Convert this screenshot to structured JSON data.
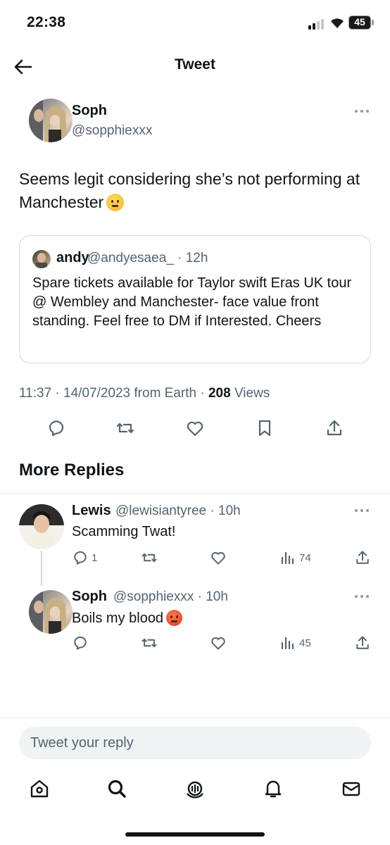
{
  "status_bar": {
    "time": "22:38",
    "battery": "45"
  },
  "header": {
    "title": "Tweet"
  },
  "tweet": {
    "name": "Soph",
    "handle": "@sopphiexxx",
    "text": "Seems legit considering she’s not performing at Manchester",
    "text_emoji": "thinking-face",
    "quote": {
      "name": "andy",
      "handle": "@andyesaea_",
      "time": "· 12h",
      "text": "Spare tickets available for Taylor swift Eras UK tour @ Wembley and Manchester- face value front standing. Feel free to DM if Interested. Cheers"
    },
    "meta": {
      "time": "11:37",
      "date": "· 14/07/2023 from Earth ·",
      "views_count": "208",
      "views_label": "Views"
    }
  },
  "more_replies": {
    "title": "More Replies"
  },
  "replies": [
    {
      "name": "Lewis",
      "handle": "@lewisiantyree",
      "time": "· 10h",
      "text": "Scamming Twat!",
      "reply_count": "1",
      "views": "74"
    },
    {
      "name": "Soph",
      "handle": "@sopphiexxx",
      "time": "· 10h",
      "text": "Boils my blood",
      "text_emoji": "angry-face",
      "reply_count": "",
      "views": "45"
    }
  ],
  "composer": {
    "placeholder": "Tweet your reply"
  },
  "colors": {
    "text": "#0f1419",
    "secondary": "#536471",
    "border": "#cfd9de",
    "input_bg": "#eff3f4"
  }
}
